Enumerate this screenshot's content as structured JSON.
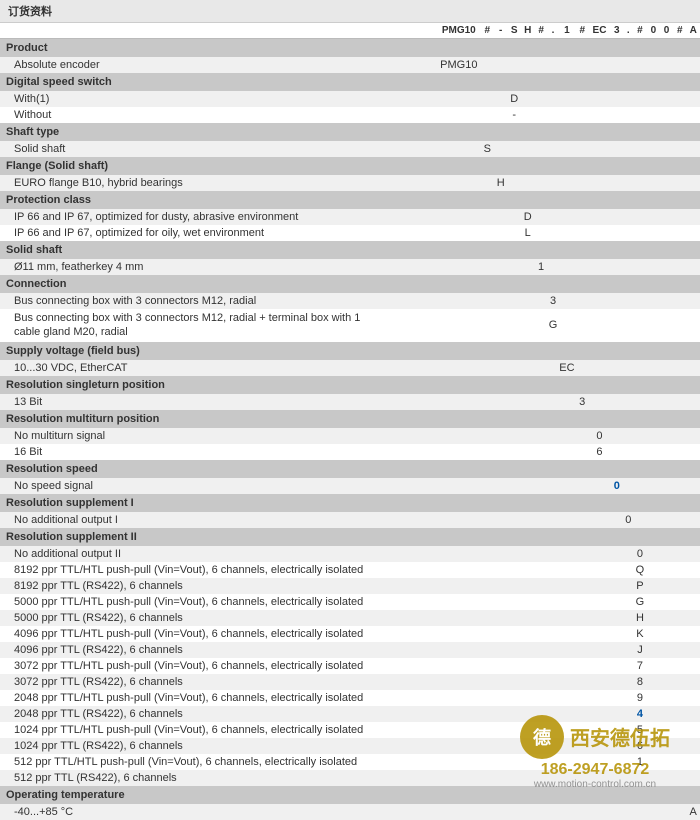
{
  "title": "订货资料",
  "header_codes": [
    "PMG10",
    "#",
    "-",
    "S",
    "H",
    "#",
    ".",
    "1",
    "#",
    "EC",
    "3",
    ".",
    "#",
    "0",
    "0",
    "#",
    "A"
  ],
  "sections": [
    {
      "type": "section",
      "label": "Product"
    },
    {
      "type": "row",
      "label": "Absolute encoder",
      "value": "PMG10",
      "col": 0,
      "bg": "light"
    },
    {
      "type": "section",
      "label": "Digital speed switch"
    },
    {
      "type": "row",
      "label": "With(1)",
      "value": "D",
      "col": 3,
      "bg": "light"
    },
    {
      "type": "row",
      "label": "Without",
      "value": "-",
      "col": 3,
      "bg": "white"
    },
    {
      "type": "section",
      "label": "Shaft type"
    },
    {
      "type": "row",
      "label": "Solid shaft",
      "value": "S",
      "col": 1,
      "bg": "light"
    },
    {
      "type": "section",
      "label": "Flange (Solid shaft)"
    },
    {
      "type": "row",
      "label": "EURO flange B10, hybrid bearings",
      "value": "H",
      "col": 2,
      "bg": "light"
    },
    {
      "type": "section",
      "label": "Protection class"
    },
    {
      "type": "row",
      "label": "IP 66 and IP 67, optimized for dusty, abrasive environment",
      "value": "D",
      "col": 4,
      "bg": "light"
    },
    {
      "type": "row",
      "label": "IP 66 and IP 67, optimized for oily, wet environment",
      "value": "L",
      "col": 4,
      "bg": "white"
    },
    {
      "type": "section",
      "label": "Solid shaft"
    },
    {
      "type": "row",
      "label": "Ø11 mm, featherkey 4 mm",
      "value": "1",
      "col": 5,
      "bg": "light"
    },
    {
      "type": "section",
      "label": "Connection"
    },
    {
      "type": "row",
      "label": "Bus connecting box with 3 connectors M12, radial",
      "value": "3",
      "col": 6,
      "bg": "light"
    },
    {
      "type": "row",
      "label": "Bus connecting box with 3 connectors M12, radial + terminal box with 1 cable gland M20, radial",
      "value": "G",
      "col": 6,
      "bg": "white",
      "multiline": true
    },
    {
      "type": "section",
      "label": "Supply voltage (field bus)"
    },
    {
      "type": "row",
      "label": "10...30 VDC, EtherCAT",
      "value": "EC",
      "col": 7,
      "bg": "light"
    },
    {
      "type": "section",
      "label": "Resolution singleturn position"
    },
    {
      "type": "row",
      "label": "13 Bit",
      "value": "3",
      "col": 8,
      "bg": "light"
    },
    {
      "type": "section",
      "label": "Resolution multiturn position"
    },
    {
      "type": "row",
      "label": "No multiturn signal",
      "value": "0",
      "col": 9,
      "bg": "light"
    },
    {
      "type": "row",
      "label": "16 Bit",
      "value": "6",
      "col": 9,
      "bg": "white"
    },
    {
      "type": "section",
      "label": "Resolution speed"
    },
    {
      "type": "row",
      "label": "No speed signal",
      "value": "0",
      "col": 10,
      "bg": "light",
      "value_color": "blue"
    },
    {
      "type": "section",
      "label": "Resolution supplement I"
    },
    {
      "type": "row",
      "label": "No additional output I",
      "value": "0",
      "col": 11,
      "bg": "light"
    },
    {
      "type": "section",
      "label": "Resolution supplement II"
    },
    {
      "type": "row",
      "label": "No additional output II",
      "value": "0",
      "col": 12,
      "bg": "light"
    },
    {
      "type": "row",
      "label": "8192 ppr TTL/HTL push-pull (Vin=Vout), 6 channels, electrically isolated",
      "value": "Q",
      "col": 12,
      "bg": "white"
    },
    {
      "type": "row",
      "label": "8192 ppr TTL (RS422), 6 channels",
      "value": "P",
      "col": 12,
      "bg": "light"
    },
    {
      "type": "row",
      "label": "5000 ppr TTL/HTL push-pull (Vin=Vout), 6 channels, electrically isolated",
      "value": "G",
      "col": 12,
      "bg": "white"
    },
    {
      "type": "row",
      "label": "5000 ppr TTL (RS422), 6 channels",
      "value": "H",
      "col": 12,
      "bg": "light"
    },
    {
      "type": "row",
      "label": "4096 ppr TTL/HTL push-pull (Vin=Vout), 6 channels, electrically isolated",
      "value": "K",
      "col": 12,
      "bg": "white"
    },
    {
      "type": "row",
      "label": "4096 ppr TTL (RS422), 6 channels",
      "value": "J",
      "col": 12,
      "bg": "light"
    },
    {
      "type": "row",
      "label": "3072 ppr TTL/HTL push-pull (Vin=Vout), 6 channels, electrically isolated",
      "value": "7",
      "col": 12,
      "bg": "white"
    },
    {
      "type": "row",
      "label": "3072 ppr TTL (RS422), 6 channels",
      "value": "8",
      "col": 12,
      "bg": "light"
    },
    {
      "type": "row",
      "label": "2048 ppr TTL/HTL push-pull (Vin=Vout), 6 channels, electrically isolated",
      "value": "9",
      "col": 12,
      "bg": "white"
    },
    {
      "type": "row",
      "label": "2048 ppr TTL (RS422), 6 channels",
      "value": "4",
      "col": 12,
      "bg": "light",
      "value_color": "blue"
    },
    {
      "type": "row",
      "label": "1024 ppr TTL/HTL push-pull (Vin=Vout), 6 channels, electrically isolated",
      "value": "5",
      "col": 12,
      "bg": "white"
    },
    {
      "type": "row",
      "label": "1024 ppr TTL (RS422), 6 channels",
      "value": "6",
      "col": 12,
      "bg": "light"
    },
    {
      "type": "row",
      "label": "512 ppr TTL/HTL push-pull (Vin=Vout), 6 channels, electrically isolated",
      "value": "1",
      "col": 12,
      "bg": "white"
    },
    {
      "type": "row",
      "label": "512 ppr TTL (RS422), 6 channels",
      "value": "",
      "col": 12,
      "bg": "light"
    },
    {
      "type": "section",
      "label": "Operating temperature"
    },
    {
      "type": "row",
      "label": "-40...+85 °C",
      "value": "A",
      "col": 16,
      "bg": "light"
    }
  ],
  "watermark": {
    "company": "西安德伍拓",
    "phone": "186-2947-6872",
    "website": "www.motion-control.com.cn"
  }
}
